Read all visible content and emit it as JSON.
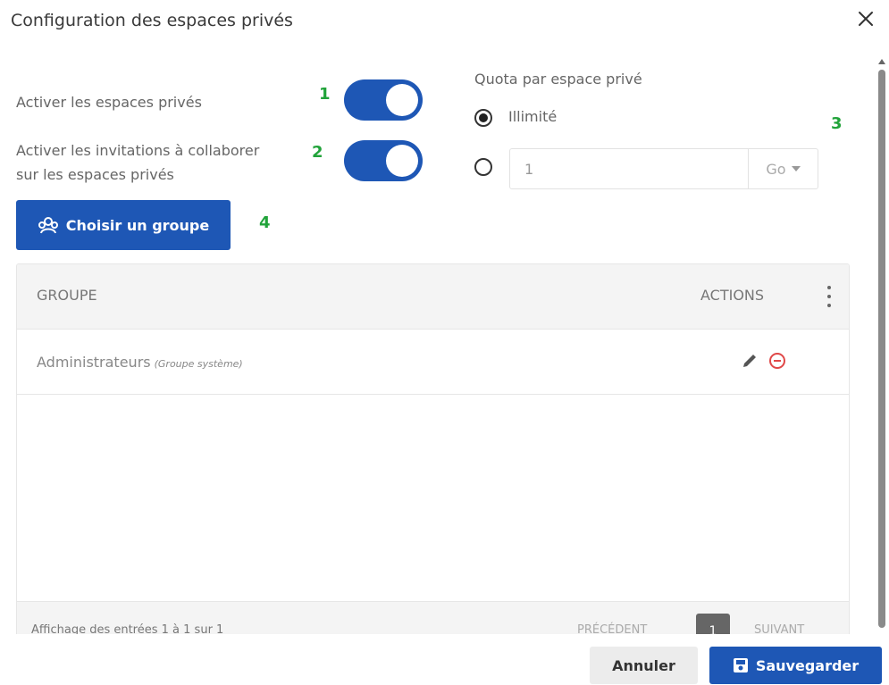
{
  "dialog": {
    "title": "Configuration des espaces privés",
    "close_icon": "close-icon"
  },
  "settings": {
    "enable_private_spaces_label": "Activer les espaces privés",
    "enable_private_spaces": true,
    "enable_invitations_label_line1": "Activer les invitations à collaborer",
    "enable_invitations_label_line2": "sur les espaces privés",
    "enable_invitations": true
  },
  "quota": {
    "title": "Quota par espace privé",
    "unlimited_label": "Illimité",
    "unlimited_selected": true,
    "custom_value": "1",
    "unit": "Go"
  },
  "markers": {
    "m1": "1",
    "m2": "2",
    "m3": "3",
    "m4": "4"
  },
  "choose_group_button": {
    "label": "Choisir un groupe",
    "icon": "group-icon"
  },
  "table": {
    "columns": {
      "group": "GROUPE",
      "actions": "ACTIONS"
    },
    "rows": [
      {
        "name": "Administrateurs",
        "note": "(Groupe système)"
      }
    ],
    "footer_text": "Affichage des entrées 1 à 1 sur 1",
    "pagination": {
      "previous": "PRÉCÉDENT",
      "current_page": "1",
      "next": "SUIVANT"
    }
  },
  "footer": {
    "cancel_label": "Annuler",
    "save_label": "Sauvegarder"
  },
  "colors": {
    "primary": "#1e57b5",
    "marker_green": "#21a33a",
    "remove_red": "#e04848"
  }
}
